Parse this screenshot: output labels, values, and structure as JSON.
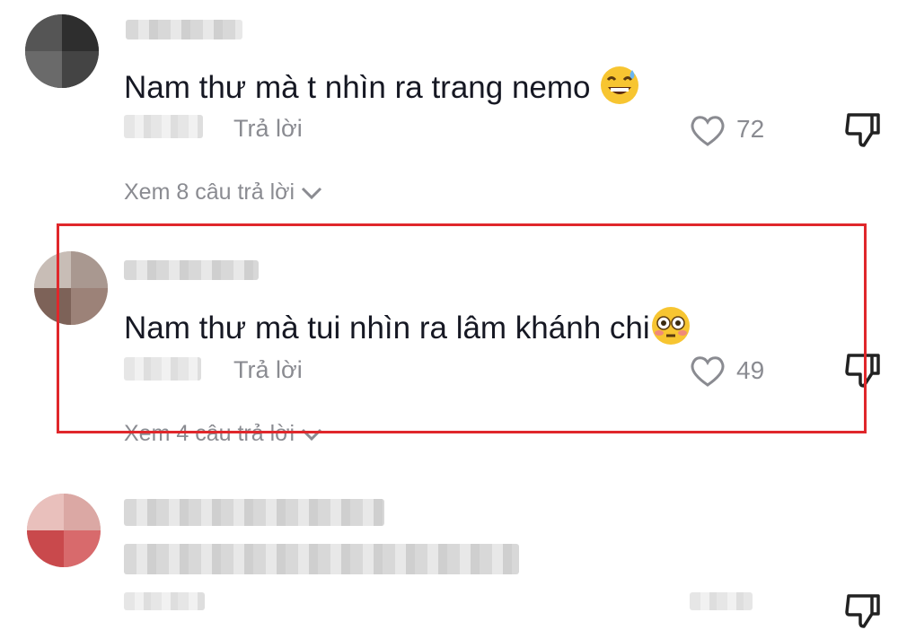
{
  "comments": [
    {
      "text": "Nam thư mà t nhìn ra trang nemo",
      "emoji_icon": "grinning-sweat-emoji",
      "reply_label": "Trả lời",
      "likes": "72",
      "view_replies": "Xem 8 câu trả lời"
    },
    {
      "text": "Nam thư mà tui nhìn ra lâm khánh chi",
      "emoji_icon": "flushed-face-emoji",
      "reply_label": "Trả lời",
      "likes": "49",
      "view_replies": "Xem 4 câu trả lời",
      "highlighted": true
    },
    {
      "text": "",
      "blurred": true
    }
  ],
  "colors": {
    "text": "#161823",
    "muted": "#8a8b91",
    "highlight": "#e0272b"
  }
}
